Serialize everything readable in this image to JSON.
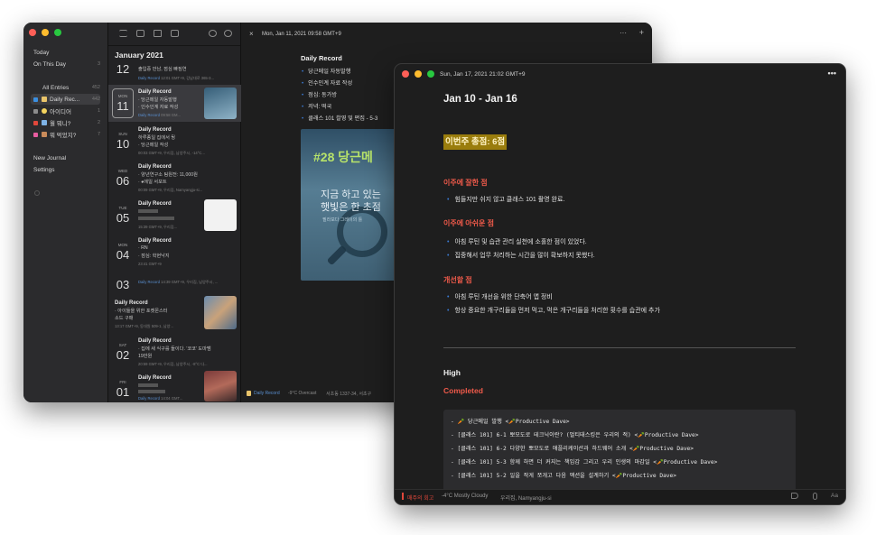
{
  "sidebar": {
    "today": "Today",
    "on_this_day": "On This Day",
    "on_this_day_count": "3",
    "all_entries": "All Entries",
    "all_entries_count": "452",
    "journals": [
      {
        "name": "Daily Rec...",
        "count": "442",
        "color": "#3b8fe0"
      },
      {
        "name": "아이디어",
        "count": "1",
        "color": "#8c8c8c"
      },
      {
        "name": "월 뭐니?",
        "count": "2",
        "color": "#e0473b"
      },
      {
        "name": "뭐 먹었지?",
        "count": "7",
        "color": "#e85da0"
      }
    ],
    "new_journal": "New Journal",
    "settings": "Settings"
  },
  "list": {
    "month": "January 2021",
    "entries": [
      {
        "dow": "",
        "day": "12",
        "title": "",
        "lines": [
          "출입증 만남, 점심 빠짐연"
        ],
        "meta_journal": "Daily Record",
        "meta": "12:01 GMT+9, 강남대로 365-3..."
      },
      {
        "dow": "MON",
        "day": "11",
        "title": "Daily Record",
        "lines": [
          "당근메일 자동발행",
          "인수인계 자료 작성"
        ],
        "meta_journal": "Daily Record",
        "meta": "09:58 GM..."
      },
      {
        "dow": "SUN",
        "day": "10",
        "title": "Daily Record",
        "lines": [
          "하루종일 집에서 뒹",
          "당근메일 작성"
        ],
        "meta_journal": "",
        "meta": "00:03 GMT+9, 우리집, 남양주시, -14°C..."
      },
      {
        "dow": "WED",
        "day": "06",
        "title": "Daily Record",
        "lines": [
          "양년연구소 팀원전: 11,000원",
          "●에일 서포트"
        ],
        "meta_journal": "",
        "meta": "00:09 GMT+9, 우리집, Namyangju-si..."
      },
      {
        "dow": "TUE",
        "day": "05",
        "title": "Daily Record",
        "lines": [
          "",
          ""
        ],
        "meta_journal": "",
        "meta": "15:39 GMT+9, 우리집..."
      },
      {
        "dow": "MON",
        "day": "04",
        "title": "Daily Record",
        "lines": [
          "RN",
          "점심: 학현낙지"
        ],
        "meta_journal": "",
        "meta": "23:41 GMT+9"
      },
      {
        "dow": "",
        "day": "03",
        "title": "",
        "lines": [],
        "meta_journal": "Daily Record",
        "meta": "14:39 GMT+9, 우리집, 남양주시, ..."
      },
      {
        "dow": "",
        "day": "",
        "title": "Daily Record",
        "lines": [
          "아이들을 위한 포켓몬스터",
          "소드 구매"
        ],
        "meta_journal": "",
        "meta": "13:17 GMT+9, 동대원 509-1, 남양..."
      },
      {
        "dow": "SAT",
        "day": "02",
        "title": "Daily Record",
        "lines": [
          "집에 새 식구를 들이다. '코코' 도마뱀",
          "19만원"
        ],
        "meta_journal": "",
        "meta": "20:59 GMT+9, 우리집, 남양주시, -8°C 다..."
      },
      {
        "dow": "FRI",
        "day": "01",
        "title": "Daily Record",
        "lines": [
          "",
          ""
        ],
        "meta_journal": "Daily Record",
        "meta": "14:04 GMT..."
      }
    ]
  },
  "main": {
    "date": "Mon, Jan 11, 2021 09:58 GMT+9",
    "title": "Daily Record",
    "bullets": [
      "당근메일 자동발행",
      "인수인계 자료 작성",
      "점심: 동가방",
      "저녁: 떡국",
      "클래스 101 촬영 및 편집 - 5-3"
    ],
    "image": {
      "tag": "#28 당근메",
      "line1": "지금 하고 있는",
      "line2": "햇빛은 한 초점",
      "line3": "필라보다 그레이의 틀"
    },
    "footer_journal": "Daily Record",
    "footer_weather": "-9°C Overcast",
    "footer_location": "서초동 1337-34, 서초구"
  },
  "front": {
    "date": "Sun, Jan 17, 2021 21:02 GMT+9",
    "heading": "Jan 10 - Jan 16",
    "score": "이번주 총점: 6점",
    "good_title": "이주에 잘한 점",
    "good_items": [
      "힘들지만 쉬지 않고 클래스 101 촬영 완료."
    ],
    "bad_title": "이주에 아쉬운 점",
    "bad_items": [
      "아침 루틴 및 습관 관리 실천에 소홀한 점이 있었다.",
      "집중해서 업무 처리하는 시간을 많이 확보하지 못했다."
    ],
    "improve_title": "개선할 점",
    "improve_items": [
      "아침 루틴 개선을 위한 단축어 앱 정비",
      "항상 중요한 개구리들을 먼저 먹고, 먹은 개구리들을 처리한 횟수를 습관에 추가"
    ],
    "high": "High",
    "completed": "Completed",
    "code_lines": [
      "- 🥕 당근메일 발행 <🥕Productive Dave>",
      "- [클래스 101] 6-1 뽀모도로 테크닉이란? (멀티태스킹은 우리의 적)  <🥕Productive Dave>",
      "- [클래스 101] 6-2 다양한 뽀모도로 애플리케이션과 하드웨어 소개 <🥕Productive Dave>",
      "- [클래스 101] 5-3 함께 하면 더 커지는 책임감 그리고 우리 인생의 마감일  <🥕Productive Dave>",
      "- [클래스 101] 5-2 일을 작게 쪼개고 다음 액션을 설계하기  <🥕Productive Dave>"
    ],
    "footer_journal": "매주의 회고",
    "footer_weather": "-4°C Mostly Cloudy",
    "footer_location": "우리집, Namyangju-si",
    "footer_font": "Aa"
  }
}
